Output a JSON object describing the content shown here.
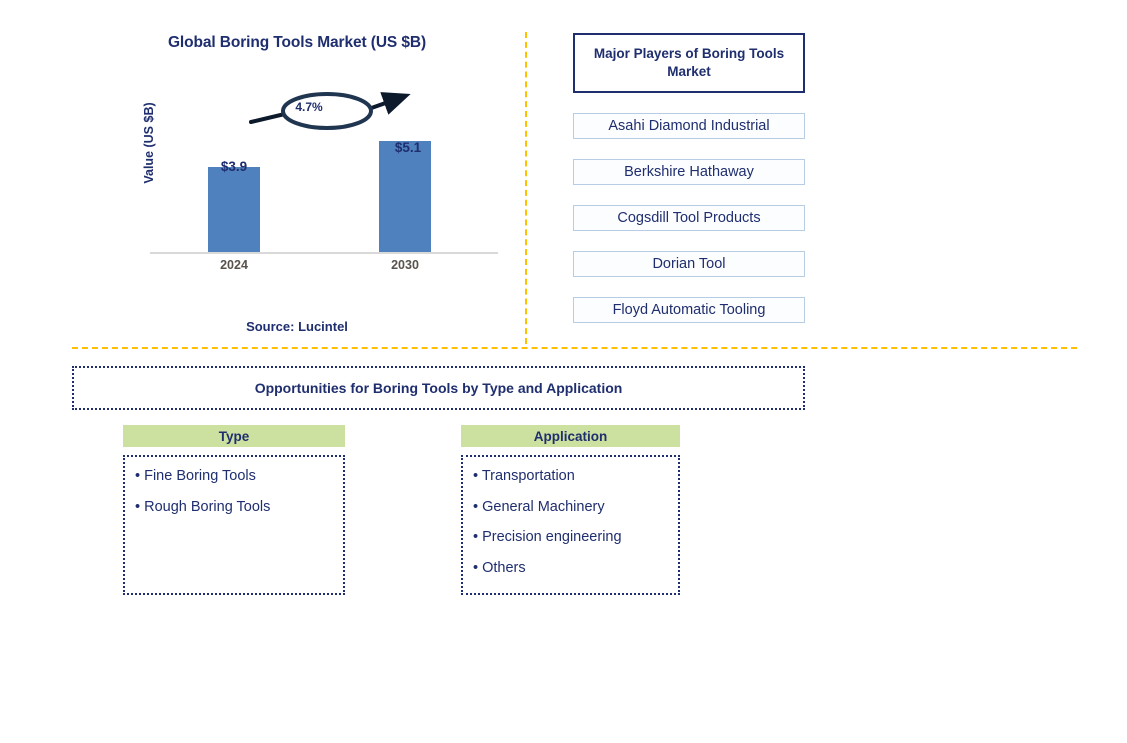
{
  "chart": {
    "title": "Global Boring Tools Market (US $B)",
    "y_axis_title": "Value (US $B)",
    "cagr_label": "4.7%",
    "source": "Source: Lucintel"
  },
  "chart_data": {
    "type": "bar",
    "title": "Global Boring Tools Market (US $B)",
    "categories": [
      "2024",
      "2030"
    ],
    "values": [
      3.9,
      5.1
    ],
    "value_labels": [
      "$3.9",
      "$5.1"
    ],
    "xlabel": "",
    "ylabel": "Value (US $B)",
    "ylim": [
      0,
      6
    ],
    "grid": false,
    "legend": false,
    "annotations": [
      {
        "text": "4.7%",
        "kind": "cagr-callout",
        "from": "2024",
        "to": "2030"
      }
    ],
    "series_color": "#4E81BD"
  },
  "players": {
    "header": "Major Players of Boring Tools Market",
    "items": [
      "Asahi Diamond Industrial",
      "Berkshire Hathaway",
      "Cogsdill Tool Products",
      "Dorian Tool",
      "Floyd Automatic Tooling"
    ]
  },
  "opportunities": {
    "banner": "Opportunities for Boring Tools by Type and Application",
    "columns": [
      {
        "header": "Type",
        "items": [
          "• Fine Boring Tools",
          "• Rough Boring Tools"
        ]
      },
      {
        "header": "Application",
        "items": [
          "• Transportation",
          "• General Machinery",
          "• Precision engineering",
          "• Others"
        ]
      }
    ]
  },
  "colors": {
    "bar": "#4E81BD",
    "navy": "#1F2E6E",
    "divider": "#FFC000",
    "category_header": "#CCE0A0",
    "player_border": "#B8CCE4"
  }
}
